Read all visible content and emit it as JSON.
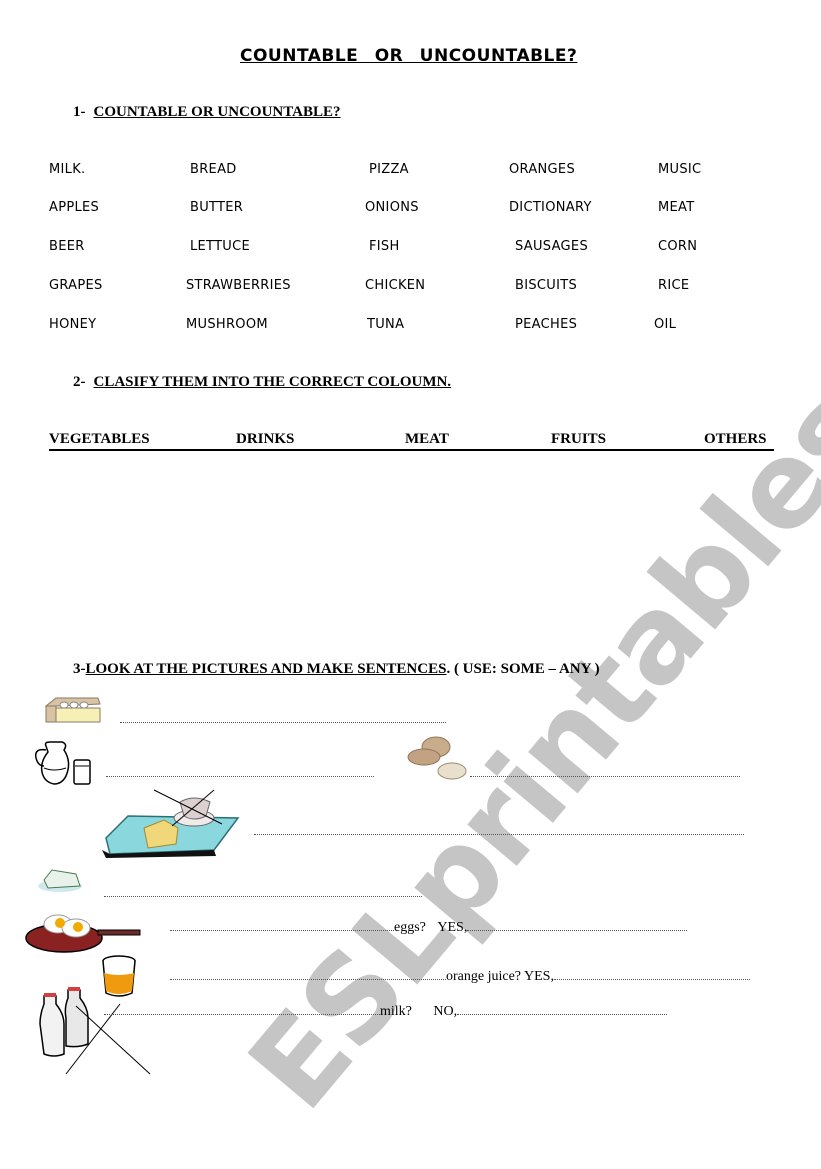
{
  "title": "COUNTABLE OR UNCOUNTABLE?",
  "section1": {
    "number": "1-",
    "heading": "COUNTABLE OR UNCOUNTABLE?",
    "words": [
      [
        "MILK.",
        "BREAD",
        "PIZZA",
        "ORANGES",
        "MUSIC"
      ],
      [
        "APPLES",
        "BUTTER",
        "ONIONS",
        "DICTIONARY",
        "MEAT"
      ],
      [
        "BEER",
        "LETTUCE",
        "FISH",
        "SAUSAGES",
        "CORN"
      ],
      [
        "GRAPES",
        "STRAWBERRIES",
        "CHICKEN",
        "BISCUITS",
        "RICE"
      ],
      [
        "HONEY",
        "MUSHROOM",
        "TUNA",
        "PEACHES",
        "OIL"
      ]
    ]
  },
  "section2": {
    "number": "2-",
    "heading": "CLASIFY THEM INTO THE CORRECT COLOUMN.",
    "columns": [
      "VEGETABLES",
      "DRINKS",
      "MEAT",
      "FRUITS",
      "OTHERS"
    ]
  },
  "section3": {
    "number": "3-",
    "heading": "LOOK AT THE PICTURES AND MAKE SENTENCES",
    "hint": ". ( USE: SOME – ANY )",
    "pictures": [
      "egg-carton",
      "milk-jug-and-glass",
      "potatoes",
      "tray-with-cheese-and-crossed-cup",
      "soap-bar",
      "fried-eggs-pan",
      "orange-juice-glass",
      "crossed-milk-bottles"
    ],
    "prompts": {
      "eggs": "eggs?",
      "eggs_answer": "YES,",
      "orange_juice": "orange juice?",
      "orange_juice_answer": "YES,",
      "milk": "milk?",
      "milk_answer": "NO,"
    }
  },
  "watermark": "ESLprintables.com"
}
